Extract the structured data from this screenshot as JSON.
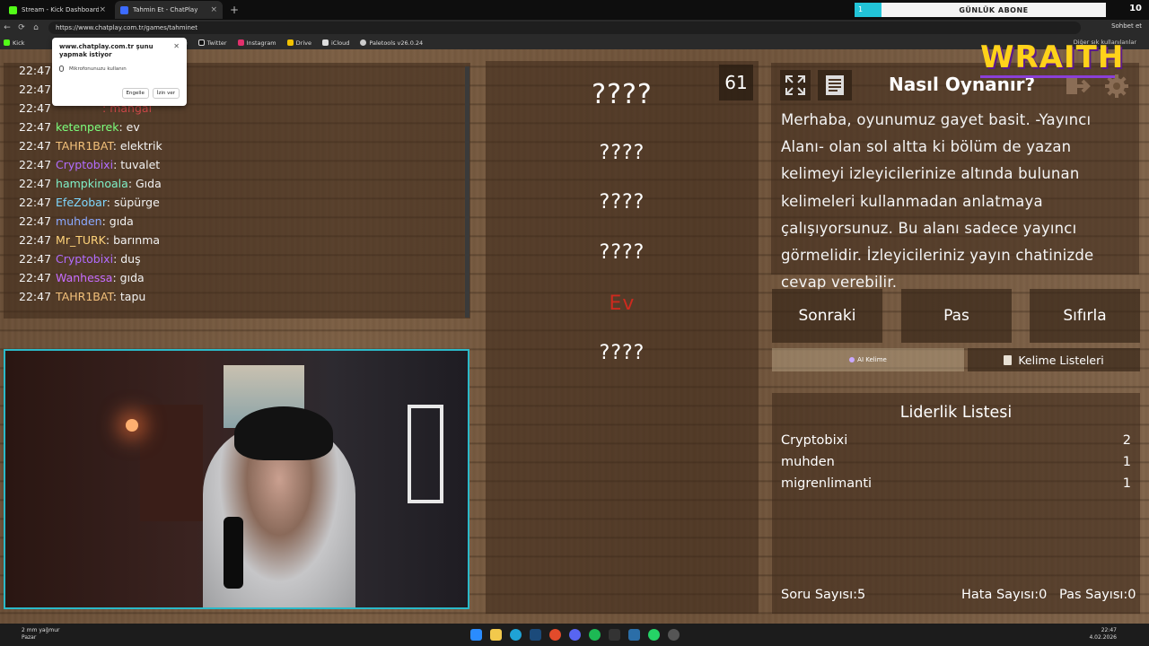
{
  "browser": {
    "tabs": [
      {
        "label": "Stream - Kick Dashboard",
        "active": false,
        "color": "#53fc18"
      },
      {
        "label": "Tahmin Et - ChatPlay",
        "active": true,
        "color": "#3c6bff"
      }
    ],
    "banner_count": "1",
    "banner_text": "GÜNLÜK ABONE",
    "tab_counter": "10",
    "url": "https://www.chatplay.com.tr/games/tahminet",
    "chat_button": "Sohbet et",
    "bookmarks": [
      {
        "label": "Kick",
        "color": "#53fc18"
      },
      {
        "label": "uTube",
        "color": "#ff0000"
      },
      {
        "label": "Twitter",
        "color": "#ffffff"
      },
      {
        "label": "Instagram",
        "color": "#e1306c"
      },
      {
        "label": "Drive",
        "color": "#f2c200"
      },
      {
        "label": "iCloud",
        "color": "#dddddd"
      },
      {
        "label": "Paletools v26.0.24",
        "color": "#cccccc"
      }
    ],
    "bookmarks_right": "Diğer sık kullanılanlar"
  },
  "permission_popup": {
    "title": "www.chatplay.com.tr şunu yapmak istiyor",
    "request": "Mikrofonunuzu kullanın",
    "block": "Engelle",
    "allow": "İzin ver"
  },
  "chat": {
    "messages": [
      {
        "time": "22:47",
        "user": "",
        "text": "",
        "color": "#ffffff"
      },
      {
        "time": "22:47",
        "user": "",
        "text": "",
        "color": "#ffffff"
      },
      {
        "time": "22:47",
        "user": "ketenperek",
        "text": "ev",
        "color": "#7cff7c"
      },
      {
        "time": "22:47",
        "user": "TAHR1BAT",
        "text": "elektrik",
        "color": "#f2c07a"
      },
      {
        "time": "22:47",
        "user": "Cryptobixi",
        "text": "tuvalet",
        "color": "#b16cff"
      },
      {
        "time": "22:47",
        "user": "hampkinoala",
        "text": "Gıda",
        "color": "#7ff0c8"
      },
      {
        "time": "22:47",
        "user": "EfeZobar",
        "text": "süpürge",
        "color": "#7fd8ff"
      },
      {
        "time": "22:47",
        "user": "muhden",
        "text": "gıda",
        "color": "#8aa8ff"
      },
      {
        "time": "22:47",
        "user": "Mr_TURK",
        "text": "barınma",
        "color": "#ffd37a"
      },
      {
        "time": "22:47",
        "user": "Cryptobixi",
        "text": "duş",
        "color": "#b16cff"
      },
      {
        "time": "22:47",
        "user": "Wanhessa",
        "text": "gıda",
        "color": "#c76cff"
      },
      {
        "time": "22:47",
        "user": "TAHR1BAT",
        "text": "tapu",
        "color": "#f2c07a"
      }
    ],
    "partial_line": {
      "time": "22:47",
      "text": ": mangal"
    }
  },
  "game": {
    "timer": "61",
    "words": [
      {
        "text": "????",
        "highlight": false
      },
      {
        "text": "????",
        "highlight": false
      },
      {
        "text": "????",
        "highlight": false
      },
      {
        "text": "????",
        "highlight": false
      },
      {
        "text": "Ev",
        "highlight": true
      },
      {
        "text": "????",
        "highlight": false
      }
    ],
    "highlight_color": "#cc2a1e"
  },
  "howto": {
    "title": "Nasıl Oynanır?",
    "text": "Merhaba, oyunumuz gayet basit. -Yayıncı Alanı- olan sol altta ki bölüm de yazan kelimeyi izleyicilerinize altında bulunan kelimeleri kullanmadan anlatmaya çalışıyorsunuz. Bu alanı sadece yayıncı görmelidir. İzleyicileriniz yayın chatinizde cevap verebilir."
  },
  "overlay_logo": "WRAITH",
  "controls": {
    "next": "Sonraki",
    "pass": "Pas",
    "reset": "Sıfırla",
    "ai_word": "AI Kelime",
    "word_lists": "Kelime Listeleri"
  },
  "leaderboard": {
    "title": "Liderlik Listesi",
    "rows": [
      {
        "name": "Cryptobixi",
        "score": "2"
      },
      {
        "name": "muhden",
        "score": "1"
      },
      {
        "name": "migrenlimanti",
        "score": "1"
      }
    ]
  },
  "stats": {
    "questions": "Soru Sayısı:5",
    "errors": "Hata Sayısı:0",
    "passes": "Pas Sayısı:0"
  },
  "taskbar": {
    "weather_temp": "2 mm yağmur",
    "weather_day": "Pazar",
    "time": "22:47",
    "date": "4.02.2026"
  }
}
